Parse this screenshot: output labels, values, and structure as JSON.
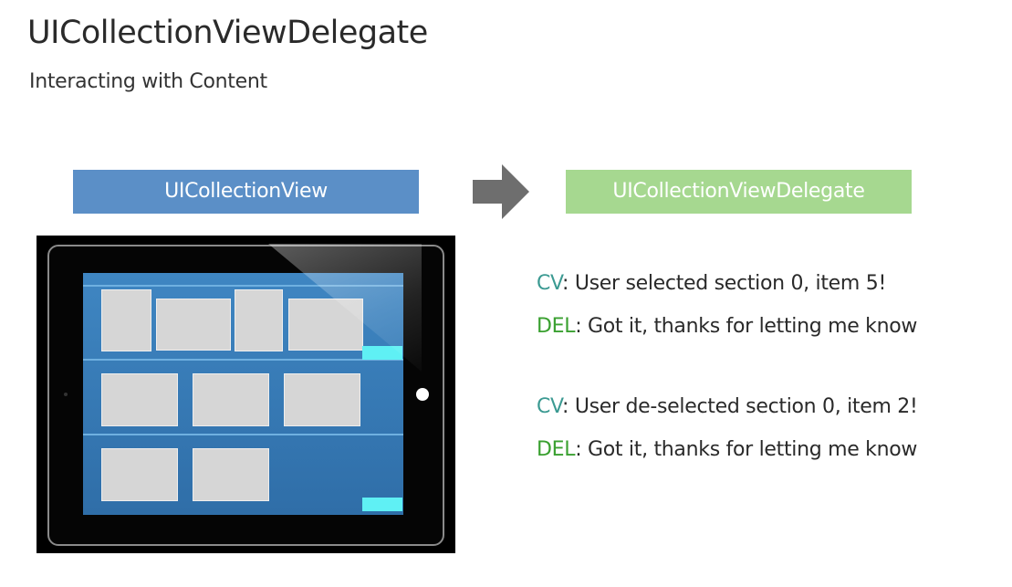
{
  "header": {
    "title": "UICollectionViewDelegate",
    "subtitle": "Interacting with Content"
  },
  "diagram": {
    "left_label": "UICollectionView",
    "right_label": "UICollectionViewDelegate",
    "colors": {
      "left_box": "#5b8fc7",
      "right_box": "#a6d890",
      "arrow": "#6e6e6e"
    }
  },
  "messages": [
    {
      "speaker": "CV",
      "text": ": User selected section 0, item 5!"
    },
    {
      "speaker": "DEL",
      "text": ": Got it, thanks for letting me know"
    },
    {
      "speaker": "CV",
      "text": ": User de-selected section 0, item 2!"
    },
    {
      "speaker": "DEL",
      "text": ": Got it, thanks for letting me know"
    }
  ]
}
